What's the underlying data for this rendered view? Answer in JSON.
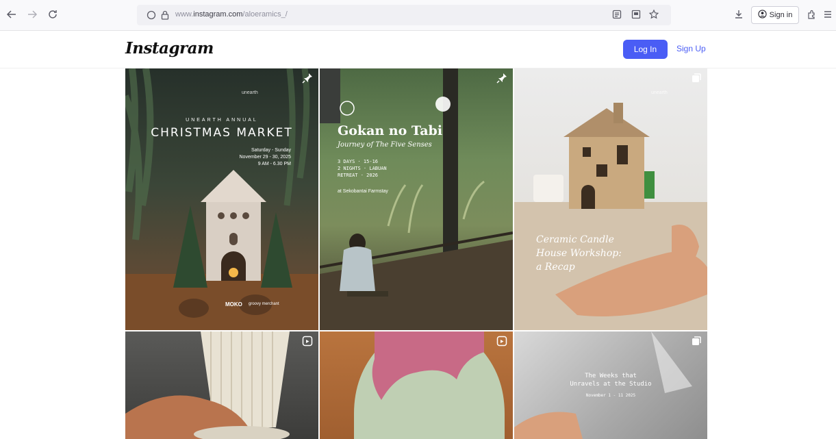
{
  "browser": {
    "url_prefix": "www.",
    "url_host": "instagram.com",
    "url_path": "/aloeramics_/",
    "signin_label": "Sign in",
    "icons": [
      "back-icon",
      "forward-icon",
      "reload-icon",
      "shield-icon",
      "lock-icon",
      "reader-icon",
      "screenshot-icon",
      "star-icon",
      "download-icon",
      "account-icon",
      "extensions-icon",
      "menu-icon"
    ]
  },
  "header": {
    "logo": "Instagram",
    "login_label": "Log In",
    "signup_label": "Sign Up"
  },
  "posts": [
    {
      "type": "pinned",
      "brand": "unearth",
      "subtitle": "UNEARTH ANNUAL",
      "title": "CHRISTMAS MARKET",
      "days": "Saturday - Sunday",
      "dates": "November 29 - 30, 2025",
      "time": "9 AM - 6.30 PM",
      "sponsor": "MOKO",
      "sponsor2": "groovy merchant"
    },
    {
      "type": "pinned",
      "title": "Gokan no Tabi",
      "subtitle": "Journey of The Five Senses",
      "line1": "3 DAYS · 15-16",
      "line2": "2 NIGHTS · LABUAN",
      "line3": "RETREAT · 2026",
      "venue": "at Sekobantai Farmstay"
    },
    {
      "type": "carousel",
      "caption_line1": "Ceramic Candle",
      "caption_line2": "House Workshop:",
      "caption_line3": "a Recap",
      "brand": "unearth"
    },
    {
      "type": "reel"
    },
    {
      "type": "reel"
    },
    {
      "type": "carousel",
      "line1": "The Weeks that",
      "line2": "Unravels at the Studio",
      "line3": "November 1 - 11 2025"
    }
  ],
  "colors": {
    "login_bg": "#4a5df5",
    "link": "#4a5df5"
  }
}
